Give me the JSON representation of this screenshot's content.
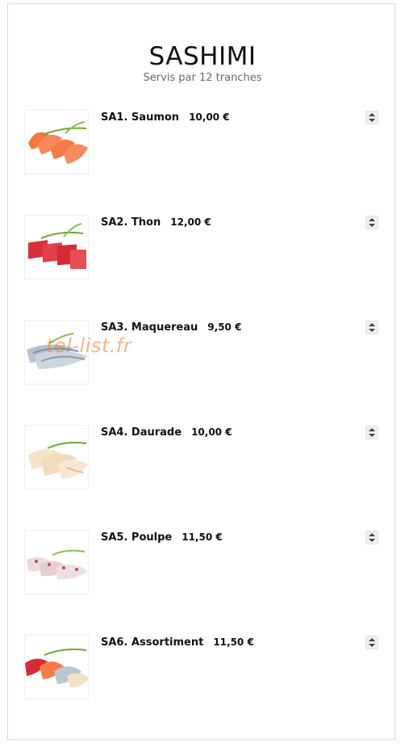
{
  "page": {
    "title": "SASHIMI",
    "subtitle": "Servis par 12 tranches"
  },
  "items": [
    {
      "label": "SA1. Saumon",
      "price": "10,00 €",
      "image_icon": "salmon-sashimi-image"
    },
    {
      "label": "SA2. Thon",
      "price": "12,00 €",
      "image_icon": "tuna-sashimi-image"
    },
    {
      "label": "SA3. Maquereau",
      "price": "9,50 €",
      "image_icon": "mackerel-sashimi-image"
    },
    {
      "label": "SA4. Daurade",
      "price": "10,00 €",
      "image_icon": "sea-bream-sashimi-image"
    },
    {
      "label": "SA5. Poulpe",
      "price": "11,50 €",
      "image_icon": "octopus-sashimi-image"
    },
    {
      "label": "SA6. Assortiment",
      "price": "11,50 €",
      "image_icon": "assorted-sashimi-image"
    }
  ],
  "watermark": "tel-list.fr",
  "colors": {
    "salmon": "#f47a4a",
    "tuna": "#d8303a",
    "mackerel": "#b9c3cf",
    "sea_bream": "#f5e2c6",
    "octopus": "#e9d4d6",
    "garnish": "#6fa83a"
  }
}
